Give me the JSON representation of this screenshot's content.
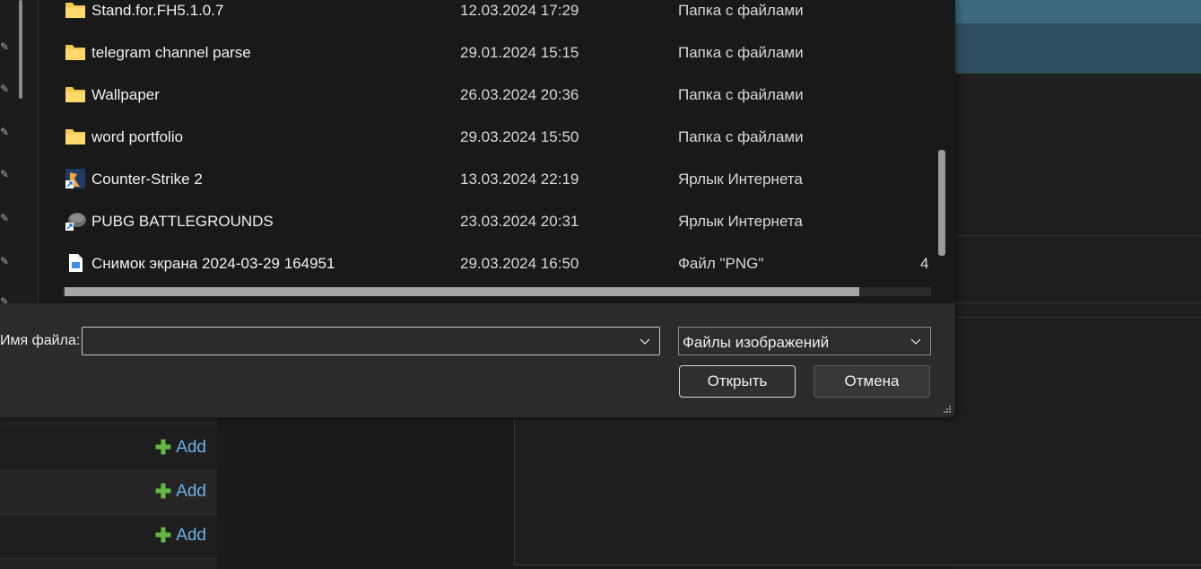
{
  "files": [
    {
      "name": "Stand.for.FH5.1.0.7",
      "date": "12.03.2024 17:29",
      "type": "Папка с файлами",
      "size": "",
      "icon": "folder-icon"
    },
    {
      "name": "telegram channel parse",
      "date": "29.01.2024 15:15",
      "type": "Папка с файлами",
      "size": "",
      "icon": "folder-icon"
    },
    {
      "name": "Wallpaper",
      "date": "26.03.2024 20:36",
      "type": "Папка с файлами",
      "size": "",
      "icon": "folder-icon"
    },
    {
      "name": "word portfolio",
      "date": "29.03.2024 15:50",
      "type": "Папка с файлами",
      "size": "",
      "icon": "folder-icon"
    },
    {
      "name": "Counter-Strike 2",
      "date": "13.03.2024 22:19",
      "type": "Ярлык Интернета",
      "size": "",
      "icon": "cs2-shortcut-icon"
    },
    {
      "name": "PUBG BATTLEGROUNDS",
      "date": "23.03.2024 20:31",
      "type": "Ярлык Интернета",
      "size": "",
      "icon": "pubg-shortcut-icon"
    },
    {
      "name": "Снимок экрана 2024-03-29 164951",
      "date": "29.03.2024 16:50",
      "type": "Файл \"PNG\"",
      "size": "4",
      "icon": "png-file-icon"
    }
  ],
  "footer": {
    "filename_label": "Имя файла:",
    "filename_value": "",
    "filter_selected": "Файлы изображений",
    "open_label": "Открыть",
    "cancel_label": "Отмена"
  },
  "background": {
    "add_label": "Add",
    "add_rows": 3
  },
  "colors": {
    "folder": "#f3c64e",
    "accent_link": "#6cb2e8",
    "plus": "#63b941"
  }
}
